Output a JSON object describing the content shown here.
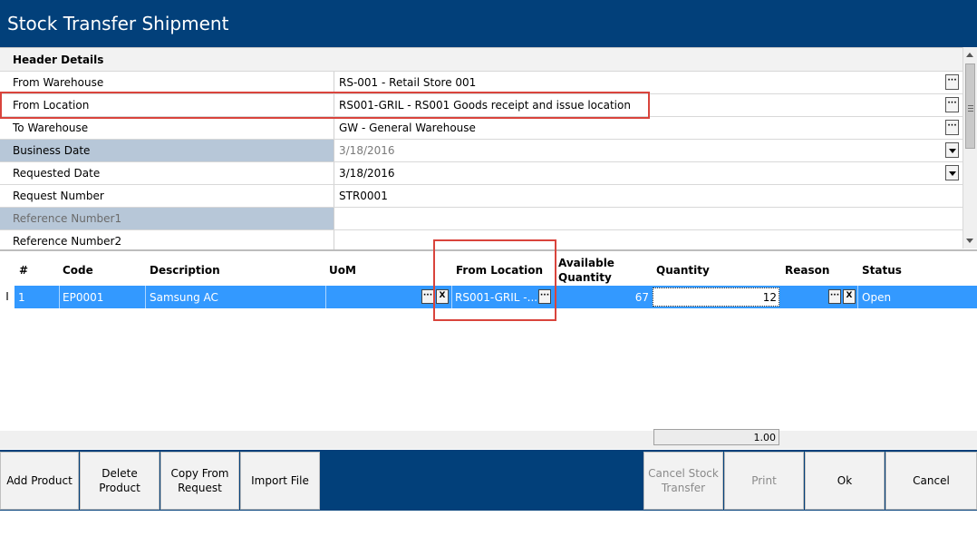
{
  "window": {
    "title": "Stock Transfer Shipment"
  },
  "header_details": {
    "section_label": "Header Details",
    "rows": [
      {
        "label": "From Warehouse",
        "value": "RS-001 - Retail Store 001",
        "control": "ellipsis-icon"
      },
      {
        "label": "From Location",
        "value": "RS001-GRIL - RS001 Goods receipt and issue location",
        "control": "ellipsis-icon"
      },
      {
        "label": "To Warehouse",
        "value": "GW - General Warehouse",
        "control": "ellipsis-icon"
      },
      {
        "label": "Business Date",
        "value": "3/18/2016",
        "control": "dropdown-icon"
      },
      {
        "label": "Requested Date",
        "value": "3/18/2016",
        "control": "dropdown-icon"
      },
      {
        "label": "Request Number",
        "value": "STR0001",
        "control": ""
      },
      {
        "label": "Reference Number1",
        "value": "",
        "control": ""
      },
      {
        "label": "Reference Number2",
        "value": "",
        "control": ""
      }
    ]
  },
  "grid": {
    "columns": [
      "#",
      "Code",
      "Description",
      "UoM",
      "From Location",
      "Available Quantity",
      "Quantity",
      "Reason",
      "Status"
    ],
    "row": {
      "marker": "I",
      "num": "1",
      "code": "EP0001",
      "description": "Samsung AC",
      "uom": "",
      "from_location": "RS001-GRIL -...",
      "available_quantity": "67",
      "quantity": "12",
      "reason": "",
      "status": "Open",
      "ellipsis": "···",
      "clear": "X"
    },
    "summary_quantity": "1.00"
  },
  "buttons": {
    "add_product": "Add  Product",
    "delete_product": "Delete Product",
    "copy_from_request": "Copy From Request",
    "import_file": "Import File",
    "cancel_stock_transfer": "Cancel Stock Transfer",
    "print": "Print",
    "ok": "Ok",
    "cancel": "Cancel"
  },
  "colors": {
    "brand": "#02407a",
    "selection": "#3399ff",
    "highlight": "#d9443c",
    "disabled_label_bg": "#b7c7d8"
  }
}
